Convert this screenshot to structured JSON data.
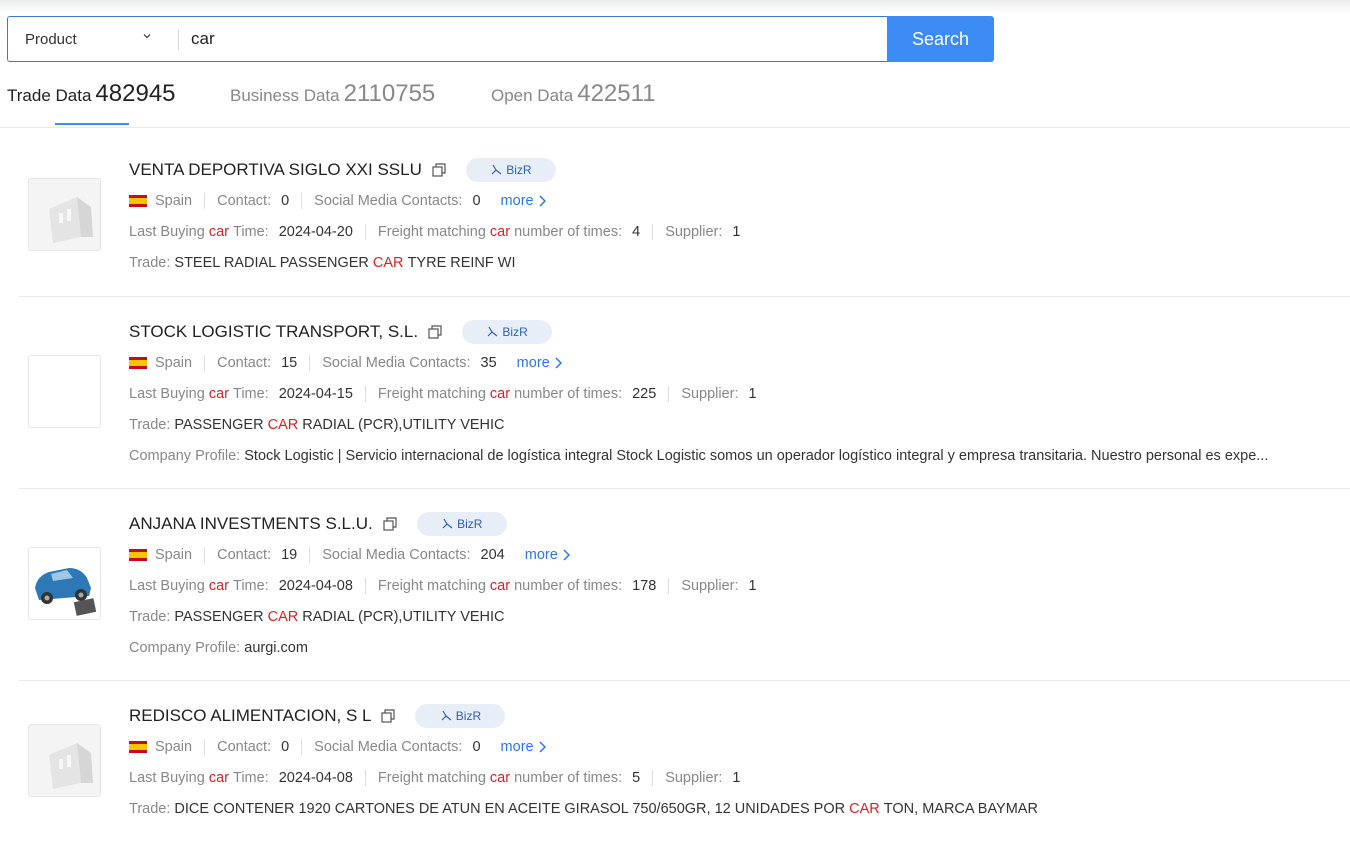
{
  "search": {
    "type_label": "Product",
    "query": "car",
    "button": "Search"
  },
  "tabs": [
    {
      "label": "Trade Data",
      "count": "482945"
    },
    {
      "label": "Business Data",
      "count": "2110755"
    },
    {
      "label": "Open Data",
      "count": "422511"
    }
  ],
  "labels": {
    "contact": "Contact:",
    "social": "Social Media Contacts:",
    "more": "more",
    "last_buying_a": "Last Buying",
    "last_buying_kw": "car",
    "last_buying_b": "Time:",
    "freight_a": "Freight matching",
    "freight_kw": "car",
    "freight_b": "number of times:",
    "supplier": "Supplier:",
    "trade": "Trade:",
    "profile": "Company Profile:",
    "bizr": "BizR"
  },
  "results": [
    {
      "name": "VENTA DEPORTIVA SIGLO XXI SSLU",
      "country": "Spain",
      "contact": "0",
      "social": "0",
      "last_time": "2024-04-20",
      "freight": "4",
      "supplier": "1",
      "trade_a": "STEEL RADIAL PASSENGER",
      "trade_kw": "CAR",
      "trade_b": "TYRE REINF WI"
    },
    {
      "name": "STOCK LOGISTIC TRANSPORT, S.L.",
      "country": "Spain",
      "contact": "15",
      "social": "35",
      "last_time": "2024-04-15",
      "freight": "225",
      "supplier": "1",
      "trade_a": "PASSENGER",
      "trade_kw": "CAR",
      "trade_b": "RADIAL (PCR),UTILITY VEHIC",
      "profile": "Stock Logistic | Servicio internacional de logística integral Stock Logistic somos un operador logístico integral y empresa transitaria. Nuestro personal es expe..."
    },
    {
      "name": "ANJANA INVESTMENTS S.L.U.",
      "country": "Spain",
      "contact": "19",
      "social": "204",
      "last_time": "2024-04-08",
      "freight": "178",
      "supplier": "1",
      "trade_a": "PASSENGER",
      "trade_kw": "CAR",
      "trade_b": "RADIAL (PCR),UTILITY VEHIC",
      "profile": "aurgi.com"
    },
    {
      "name": "REDISCO ALIMENTACION, S L",
      "country": "Spain",
      "contact": "0",
      "social": "0",
      "last_time": "2024-04-08",
      "freight": "5",
      "supplier": "1",
      "trade_a": "DICE CONTENER 1920 CARTONES DE ATUN EN ACEITE GIRASOL 750/650GR, 12 UNIDADES POR",
      "trade_kw": "CAR",
      "trade_b": "TON, MARCA BAYMAR"
    }
  ],
  "colors": {
    "accent": "#3d8bf5",
    "keyword": "#e02020",
    "link": "#2878e8"
  }
}
